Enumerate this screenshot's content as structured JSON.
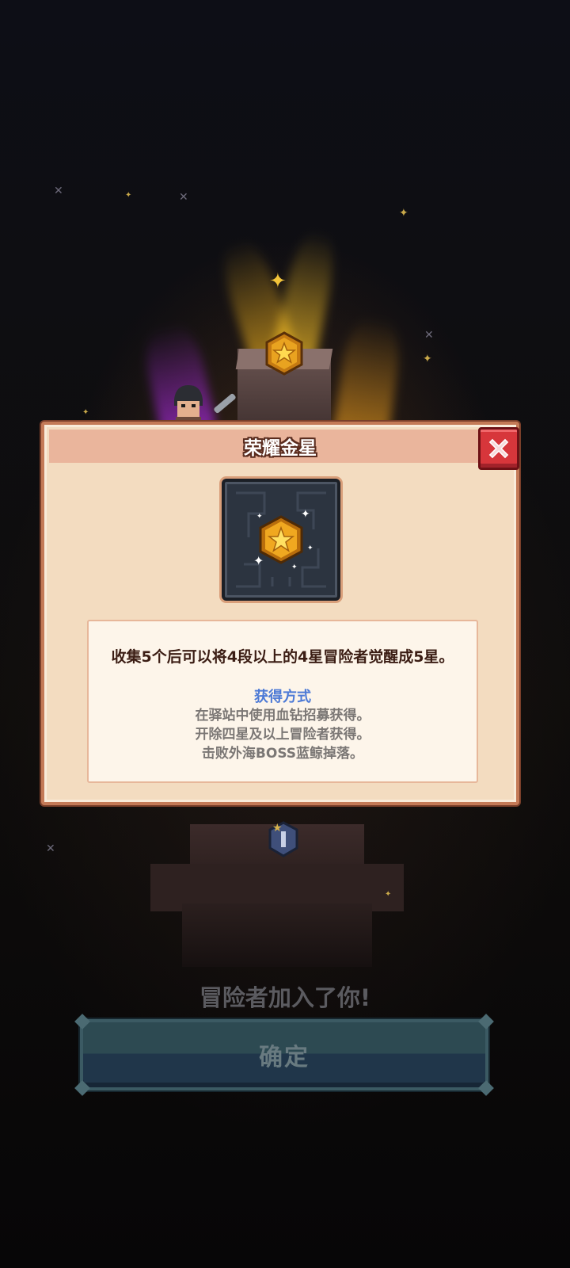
{
  "dialog": {
    "title": "荣耀金星",
    "close_icon": "close-x-icon",
    "item_icon": "gold-star-medal-icon",
    "description": "收集5个后可以将4段以上的4星冒险者觉醒成5星。",
    "obtain": {
      "title": "获得方式",
      "lines": [
        "在驿站中使用血钻招募获得。",
        "开除四星及以上冒险者获得。",
        "击败外海BOSS蓝鲸掉落。"
      ]
    }
  },
  "background": {
    "joined_text": "冒险者加入了你!",
    "confirm_label": "确定",
    "pillar_medal_icon": "gold-star-medal-icon",
    "base_medal_icon": "blue-medal-icon"
  },
  "colors": {
    "dialog_bg": "#f3dcc0",
    "header_bg": "#eab59c",
    "accent_blue": "#4d7ad6",
    "close_red": "#d7363b"
  }
}
